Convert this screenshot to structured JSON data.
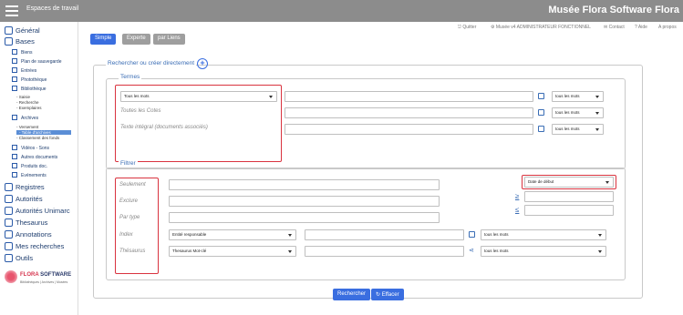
{
  "topbar": {
    "section": "Espaces de travail",
    "brand": "Musée Flora Software Flora"
  },
  "sidebar": {
    "general": "Général",
    "bases": "Bases",
    "items": [
      "Biens",
      "Plan de sauvegarde",
      "Entrées",
      "Photothèque",
      "Bibliothèque"
    ],
    "biblio_sub": [
      "- Saisie",
      "- Recherche",
      "- Exemplaires"
    ],
    "archives": "Archives",
    "archives_sub": [
      "- Versement",
      "- Table d'archives",
      "- Classement des fonds"
    ],
    "items2": [
      "Vidéos - Sons",
      "Autres documents",
      "Produits doc.",
      "Evénements"
    ],
    "main": [
      "Registres",
      "Autorités",
      "Autorités Unimarc",
      "Thesaurus",
      "Annotations",
      "Mes recherches",
      "Outils"
    ],
    "logo": {
      "name1": "FLORA",
      "name2": "SOFTWARE",
      "tagline": "Bibliothèques | Archives | Musées"
    }
  },
  "toplinks": {
    "quit": "Quitter",
    "user": "Musée v4 ADMINISTRATEUR FONCTIONNEL",
    "contact": "Contact",
    "help": "Aide",
    "about": "A propos"
  },
  "tabs": [
    "Simple",
    "Experte",
    "par Liens"
  ],
  "search_legend": "Rechercher ou créer directement",
  "termes": {
    "legend": "Termes",
    "select": "Tous les mots",
    "placeholders": [
      "Toutes les Cotes",
      "Texte intégral (documents associés)"
    ],
    "mode": "tous les mots"
  },
  "filtrer": {
    "legend": "Filtrer",
    "placeholders": [
      "Seulement",
      "Exclure",
      "Par type",
      "Index",
      "Thésaurus"
    ],
    "date_select": "Date de début",
    "ge": "≥",
    "le": "≤",
    "index_select": "Entité responsable",
    "thesaurus_select": "Thesaurus Mot-clé",
    "mode": "tous les mots"
  },
  "actions": {
    "search": "Rechercher",
    "clear": "Effacer"
  },
  "colors": {
    "accent": "#3a6ee0",
    "highlight": "#d9333f",
    "topbar": "#8c8c8c"
  }
}
